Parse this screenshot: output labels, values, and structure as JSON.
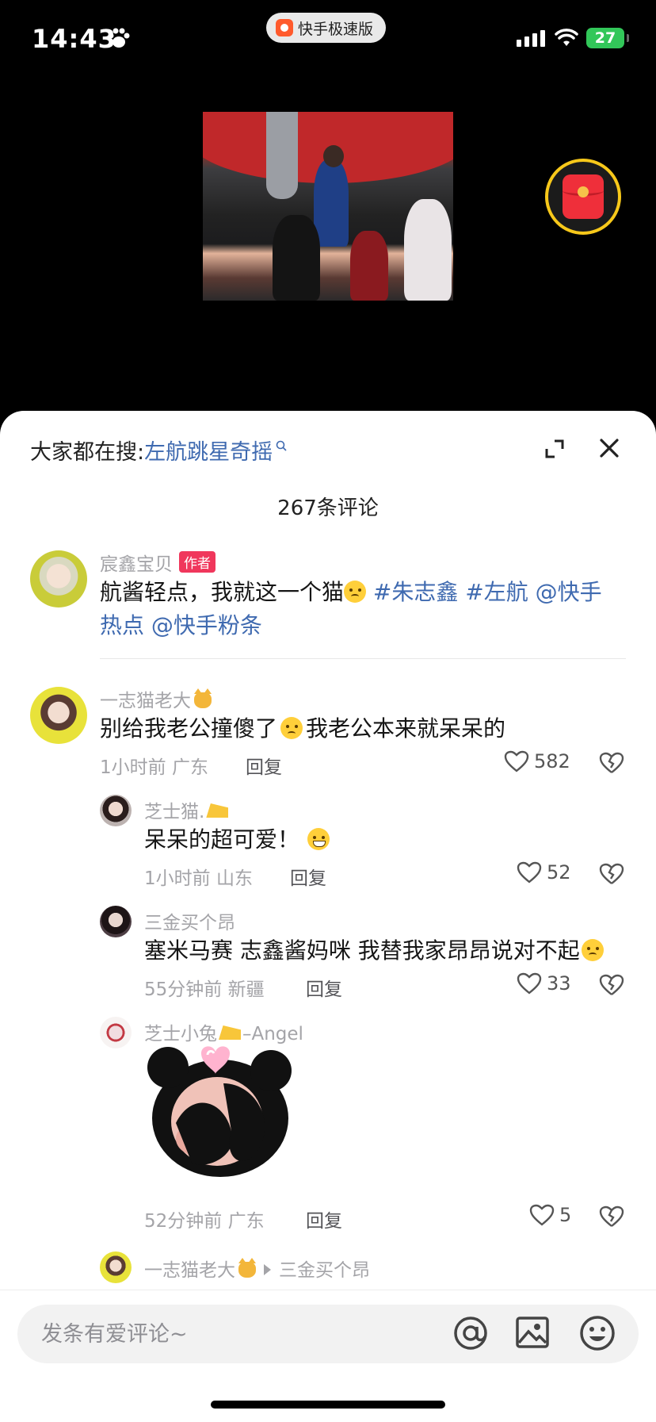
{
  "status_bar": {
    "time": "14:43",
    "app_name": "快手极速版",
    "battery": "27"
  },
  "sheet": {
    "search_prefix": "大家都在搜:",
    "search_keyword": "左航跳星奇摇",
    "comment_count": "267条评论"
  },
  "author_post": {
    "name": "宸鑫宝贝",
    "badge": "作者",
    "text_main": "航酱轻点，我就这一个猫",
    "tag1": "#朱志鑫",
    "tag2": "#左航",
    "mention1": "@快手",
    "mention1_cont": "热点",
    "mention2": "@快手粉条"
  },
  "comments": [
    {
      "name": "一志猫老大",
      "text_a": "别给我老公撞傻了",
      "text_b": "我老公本来就呆呆的",
      "meta": "1小时前 广东",
      "reply": "回复",
      "likes": "582"
    },
    {
      "name": "芝士猫.",
      "text": "呆呆的超可爱！",
      "meta": "1小时前 山东",
      "reply": "回复",
      "likes": "52"
    },
    {
      "name": "三金买个昂",
      "text": "塞米马赛 志鑫酱妈咪 我替我家昂昂说对不起",
      "meta": "55分钟前 新疆",
      "reply": "回复",
      "likes": "33"
    },
    {
      "name_a": "芝士小兔",
      "name_b": "–Angel",
      "meta": "52分钟前 广东",
      "reply": "回复",
      "likes": "5"
    },
    {
      "name": "一志猫老大",
      "reply_to": "三金买个昂"
    }
  ],
  "input_bar": {
    "placeholder": "发条有爱评论~"
  },
  "colors": {
    "link": "#3f6ab0",
    "badge": "#f0375c",
    "battery": "#32c759",
    "ring": "#f7c81a"
  }
}
